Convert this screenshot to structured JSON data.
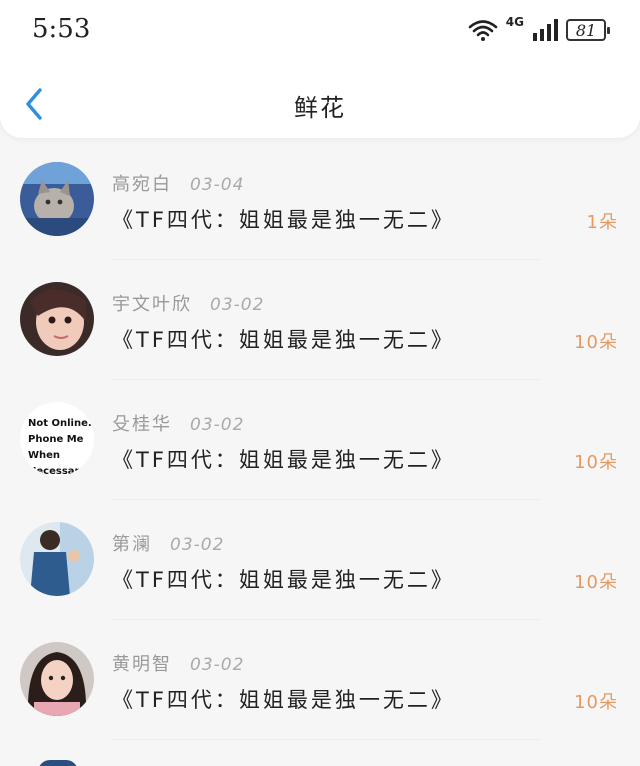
{
  "status_bar": {
    "time": "5:53",
    "network": "4G",
    "battery": "81",
    "icons": [
      "wifi-icon",
      "signal-icon",
      "battery-icon"
    ]
  },
  "header": {
    "title": "鲜花",
    "back_icon": "chevron-left-icon",
    "accent_color": "#2f8fdc"
  },
  "items": [
    {
      "name": "高宛白",
      "date": "03-04",
      "book": "《TF四代：姐姐最是独一无二》",
      "flowers": "1朵",
      "avatar": "cat-photo"
    },
    {
      "name": "宇文叶欣",
      "date": "03-02",
      "book": "《TF四代：姐姐最是独一无二》",
      "flowers": "10朵",
      "avatar": "girl-photo"
    },
    {
      "name": "殳桂华",
      "date": "03-02",
      "book": "《TF四代：姐姐最是独一无二》",
      "flowers": "10朵",
      "avatar": "text-avatar",
      "avatar_text": [
        "Not Online.",
        "Phone Me",
        "When",
        "Necessary."
      ]
    },
    {
      "name": "第澜",
      "date": "03-02",
      "book": "《TF四代：姐姐最是独一无二》",
      "flowers": "10朵",
      "avatar": "boy-photo"
    },
    {
      "name": "黄明智",
      "date": "03-02",
      "book": "《TF四代：姐姐最是独一无二》",
      "flowers": "10朵",
      "avatar": "girl-photo-2"
    }
  ],
  "colors": {
    "flower_count": "#e59a63",
    "name": "#999999",
    "book": "#222222"
  }
}
